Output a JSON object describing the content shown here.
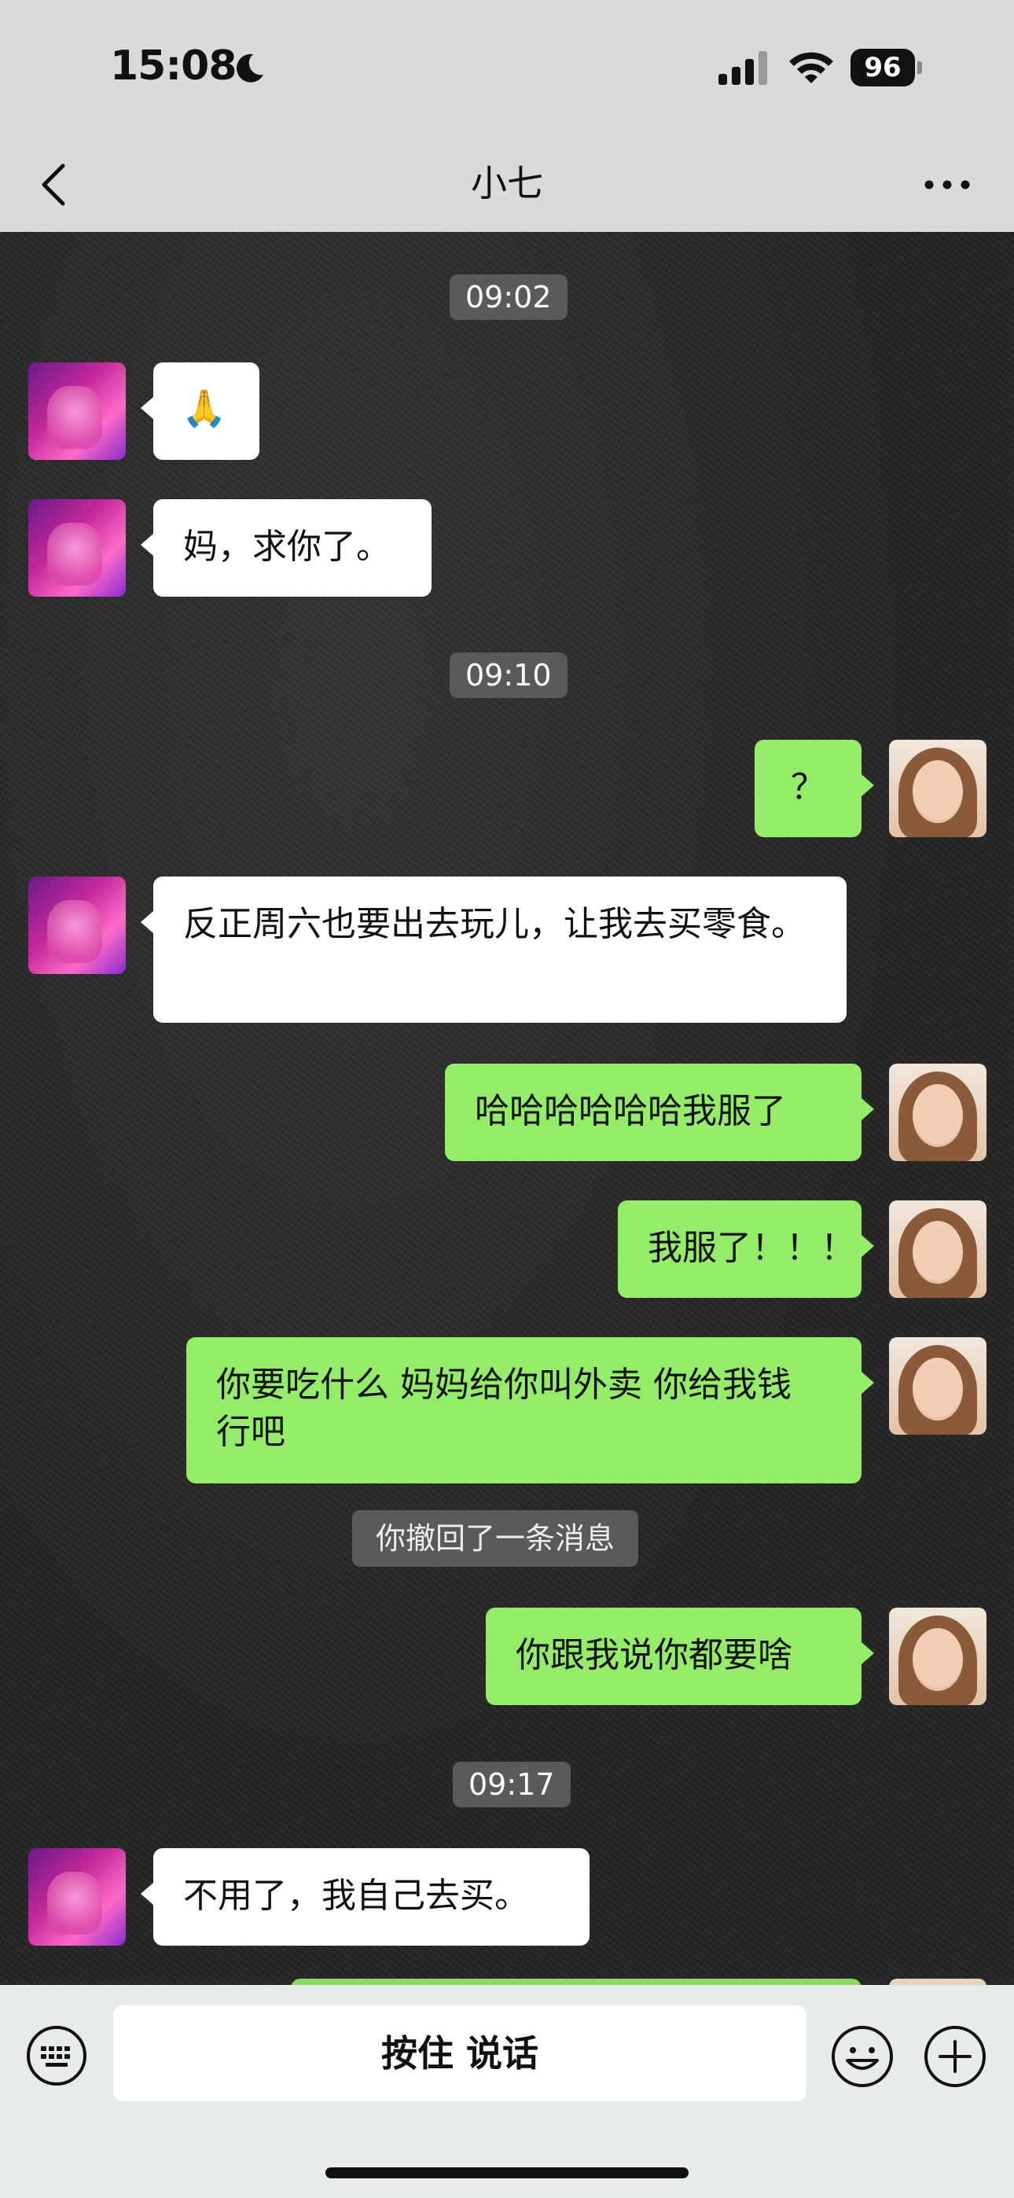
{
  "status": {
    "time": "15:08",
    "battery": "96"
  },
  "header": {
    "title": "小七"
  },
  "messages": {
    "ts1": "09:02",
    "m1": "🙏",
    "m2": "妈，求你了。",
    "ts2": "09:10",
    "m3": "？",
    "m4": "反正周六也要出去玩儿，让我去买零食。",
    "m5": "哈哈哈哈哈哈我服了",
    "m6": "我服了！！！",
    "m7": "你要吃什么 妈妈给你叫外卖 你给我钱 行吧",
    "recall": "你撤回了一条消息",
    "m8": "你跟我说你都要啥",
    "ts3": "09:17",
    "m9": "不用了，我自己去买。"
  },
  "input": {
    "voice_label": "按住 说话"
  },
  "colors": {
    "bubble_me": "#95ec69",
    "bubble_them": "#ffffff",
    "chat_bg": "#262626"
  }
}
